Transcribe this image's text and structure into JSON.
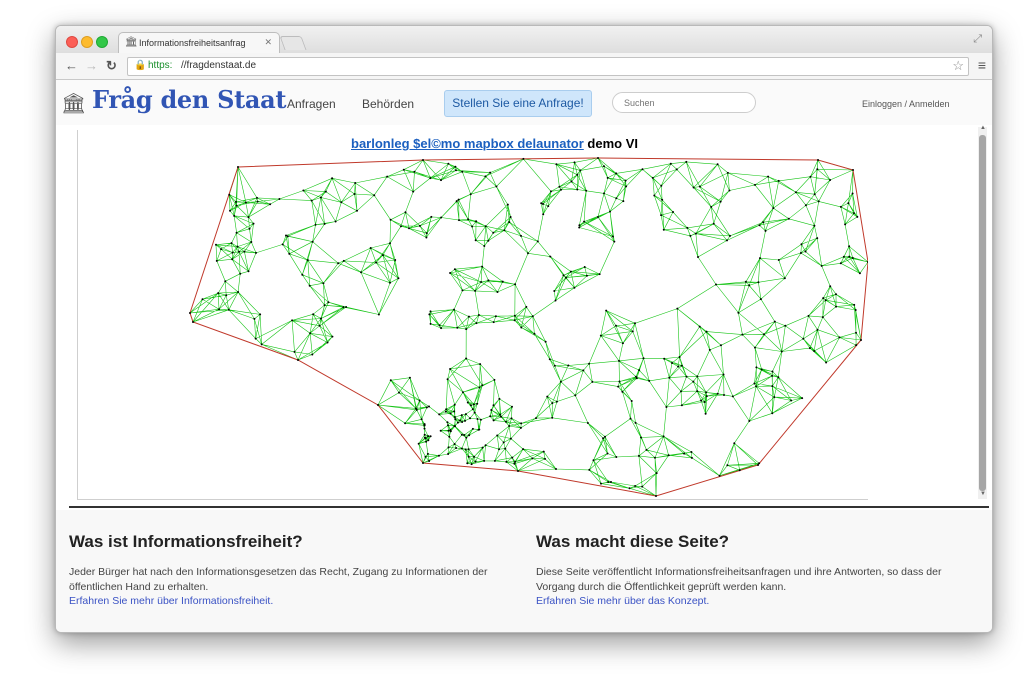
{
  "browser": {
    "tab_title": "Informationsfreiheitsanfrag",
    "url_scheme": "https:",
    "url_host": "//fragdenstaat.de"
  },
  "site": {
    "logo": "Fråg den Staat",
    "nav": [
      "Anfragen",
      "Behörden"
    ],
    "cta": "Stellen Sie eine Anfrage!",
    "search_placeholder": "Suchen",
    "login": "Einloggen / Anmelden"
  },
  "demo": {
    "link_text": "barlonleg $el©mo mapbox delaunator",
    "suffix": " demo VI",
    "colors": {
      "edges": "#17c417",
      "hull": "#c0392b",
      "points": "#000000"
    }
  },
  "info": {
    "left": {
      "heading": "Was ist Informationsfreiheit?",
      "text": "Jeder Bürger hat nach den Informationsgesetzen das Recht, Zugang zu Informationen der öffentlichen Hand zu erhalten.",
      "link": "Erfahren Sie mehr über Informationsfreiheit."
    },
    "right": {
      "heading": "Was macht diese Seite?",
      "text": "Diese Seite veröffentlicht Informationsfreiheitsanfragen und ihre Antworten, so dass der Vorgang durch die Öffentlichkeit geprüft werden kann.",
      "link": "Erfahren Sie mehr über das Konzept."
    }
  }
}
